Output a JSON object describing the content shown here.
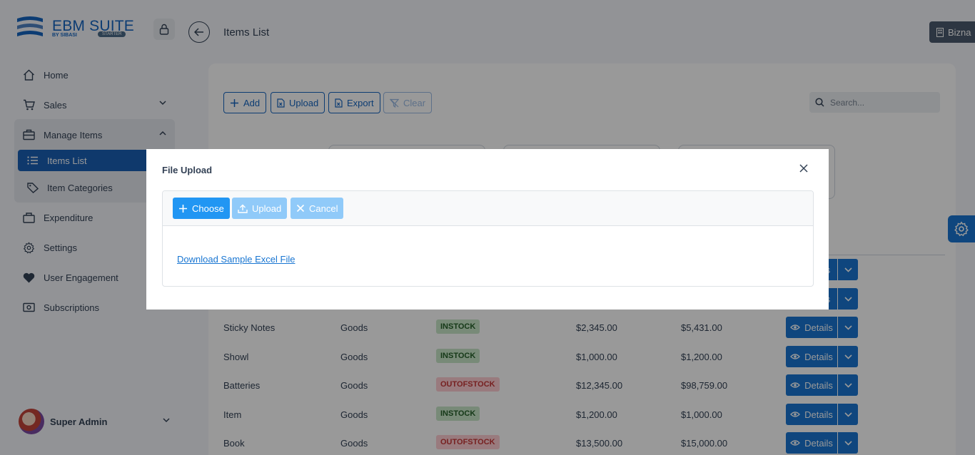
{
  "header": {
    "logo_title": "EBM SUITE",
    "logo_subtitle": "BY SIBASI",
    "logo_badge": "STARTER",
    "page_title": "Items List",
    "business_label": "Bizna"
  },
  "sidebar": {
    "items": [
      {
        "label": "Home",
        "icon": "home-icon"
      },
      {
        "label": "Sales",
        "icon": "cart-icon"
      },
      {
        "label": "Manage Items",
        "icon": "briefcase-icon"
      },
      {
        "label": "Expenditure",
        "icon": "bag-icon"
      },
      {
        "label": "Settings",
        "icon": "gear-icon"
      },
      {
        "label": "User Engagement",
        "icon": "heart-icon"
      },
      {
        "label": "Subscriptions",
        "icon": "money-icon"
      }
    ],
    "subitems": [
      {
        "label": "Items List",
        "icon": "list-icon"
      },
      {
        "label": "Item Categories",
        "icon": "tag-icon"
      }
    ],
    "user_name": "Super Admin"
  },
  "toolbar": {
    "add_label": "Add",
    "upload_label": "Upload",
    "export_label": "Export",
    "clear_label": "Clear",
    "search_placeholder": "Search..."
  },
  "table": {
    "rows": [
      {
        "name": "Sticky Notes",
        "type": "Goods",
        "status": "INSTOCK",
        "price1": "$2,345.00",
        "price2": "$5,431.00",
        "action": "Details"
      },
      {
        "name": "Showl",
        "type": "Goods",
        "status": "INSTOCK",
        "price1": "$1,000.00",
        "price2": "$1,200.00",
        "action": "Details"
      },
      {
        "name": "Batteries",
        "type": "Goods",
        "status": "OUTOFSTOCK",
        "price1": "$12,345.00",
        "price2": "$98,759.00",
        "action": "Details"
      },
      {
        "name": "Item",
        "type": "Goods",
        "status": "INSTOCK",
        "price1": "$1,200.00",
        "price2": "$1,000.00",
        "action": "Details"
      },
      {
        "name": "Book",
        "type": "Goods",
        "status": "OUTOFSTOCK",
        "price1": "$13,500.00",
        "price2": "$15,000.00",
        "action": "Details"
      }
    ],
    "partial_action_label": "s"
  },
  "dialog": {
    "title": "File Upload",
    "choose_label": "Choose",
    "upload_label": "Upload",
    "cancel_label": "Cancel",
    "sample_link": "Download Sample Excel File"
  },
  "colors": {
    "primary": "#1976d2",
    "active_nav": "#1a5fb4",
    "instock_bg": "#c8e6c9",
    "outofstock_bg": "#ffcdd2"
  }
}
